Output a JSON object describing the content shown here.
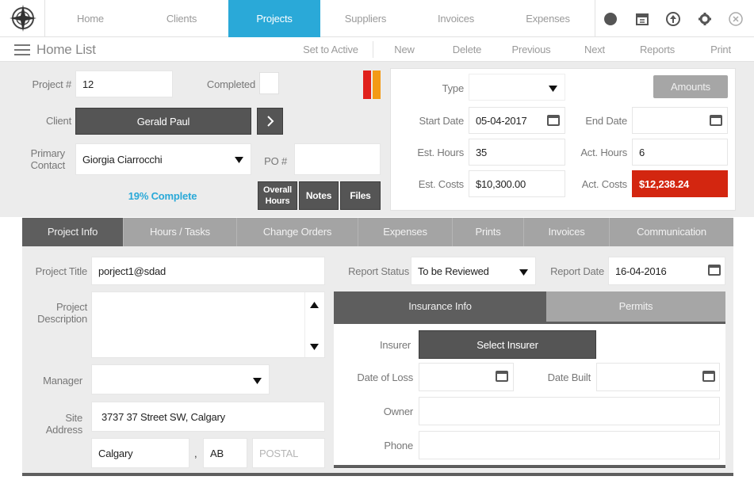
{
  "nav": {
    "items": [
      "Home",
      "Clients",
      "Projects",
      "Suppliers",
      "Invoices",
      "Expenses"
    ],
    "active": "Projects",
    "icons": [
      "record-icon",
      "calendar-icon",
      "upload-icon",
      "gear-icon",
      "close-icon"
    ]
  },
  "toolbar": {
    "title": "Home List",
    "actions": [
      "Set to Active",
      "New",
      "Delete",
      "Previous",
      "Next",
      "Reports",
      "Print"
    ]
  },
  "project": {
    "number_label": "Project #",
    "number": "12",
    "completed_label": "Completed",
    "client_label": "Client",
    "client": "Gerald Paul",
    "primary_contact_label_1": "Primary",
    "primary_contact_label_2": "Contact",
    "primary_contact": "Giorgia Ciarrocchi",
    "po_label": "PO #",
    "po": "",
    "progress_text": "19% Complete",
    "progress_color": "#2aa9d8",
    "btn_overall_1": "Overall",
    "btn_overall_2": "Hours",
    "btn_notes": "Notes",
    "btn_files": "Files",
    "flag_colors": [
      "#e0201b",
      "#f39a16"
    ]
  },
  "summary": {
    "type_label": "Type",
    "type_value": "",
    "amounts_button": "Amounts",
    "start_date_label": "Start Date",
    "start_date": "05-04-2017",
    "end_date_label": "End Date",
    "end_date": "",
    "est_hours_label": "Est. Hours",
    "est_hours": "35",
    "act_hours_label": "Act. Hours",
    "act_hours": "6",
    "est_costs_label": "Est. Costs",
    "est_costs": "$10,300.00",
    "act_costs_label": "Act. Costs",
    "act_costs": "$12,238.24",
    "act_costs_color": "#d32610"
  },
  "tabs": [
    "Project Info",
    "Hours / Tasks",
    "Change Orders",
    "Expenses",
    "Prints",
    "Invoices",
    "Communication"
  ],
  "info": {
    "title_label": "Project Title",
    "title": "porject1@sdad",
    "desc_label_1": "Project",
    "desc_label_2": "Description",
    "description": "",
    "manager_label": "Manager",
    "manager": "",
    "site_label_1": "Site",
    "site_label_2": "Address",
    "address": "3737 37 Street SW, Calgary",
    "city": "Calgary",
    "comma": ",",
    "province": "AB",
    "postal_placeholder": "POSTAL",
    "report_status_label": "Report Status",
    "report_status": "To be Reviewed",
    "report_date_label": "Report Date",
    "report_date": "16-04-2016"
  },
  "insurance": {
    "tab_insurance": "Insurance Info",
    "tab_permits": "Permits",
    "insurer_label": "Insurer",
    "select_insurer": "Select Insurer",
    "date_of_loss_label": "Date of Loss",
    "date_of_loss": "",
    "date_built_label": "Date Built",
    "date_built": "",
    "owner_label": "Owner",
    "owner": "",
    "phone_label": "Phone",
    "phone": ""
  }
}
